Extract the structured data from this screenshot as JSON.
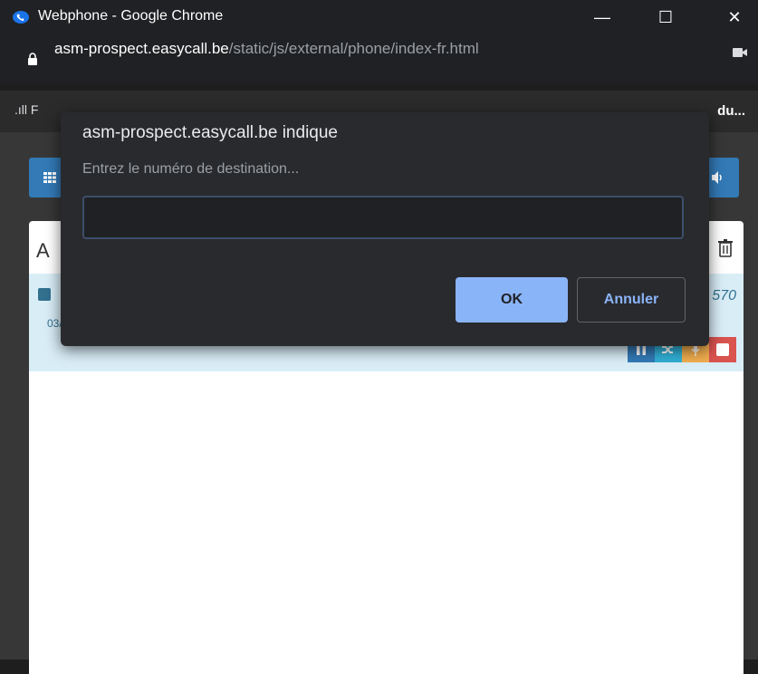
{
  "window": {
    "title": "Webphone - Google Chrome",
    "controls": {
      "minimize": "—",
      "maximize": "☐",
      "close": "✕"
    }
  },
  "address_bar": {
    "host": "asm-prospect.easycall.be",
    "path": "/static/js/external/phone/index-fr.html"
  },
  "bookmarks": {
    "left": ".ıll F",
    "right": "du..."
  },
  "call": {
    "number_partial": "570",
    "date_partial": "03/"
  },
  "panel": {
    "title_partial": "A"
  },
  "dialog": {
    "title": "asm-prospect.easycall.be indique",
    "message": "Entrez le numéro de destination...",
    "input_value": "",
    "ok_label": "OK",
    "cancel_label": "Annuler"
  },
  "colors": {
    "primary": "#337ab7",
    "info_bg": "#d9edf7",
    "warning": "#f0ad4e",
    "danger": "#d9534f",
    "dialog_button": "#8ab4f8"
  }
}
